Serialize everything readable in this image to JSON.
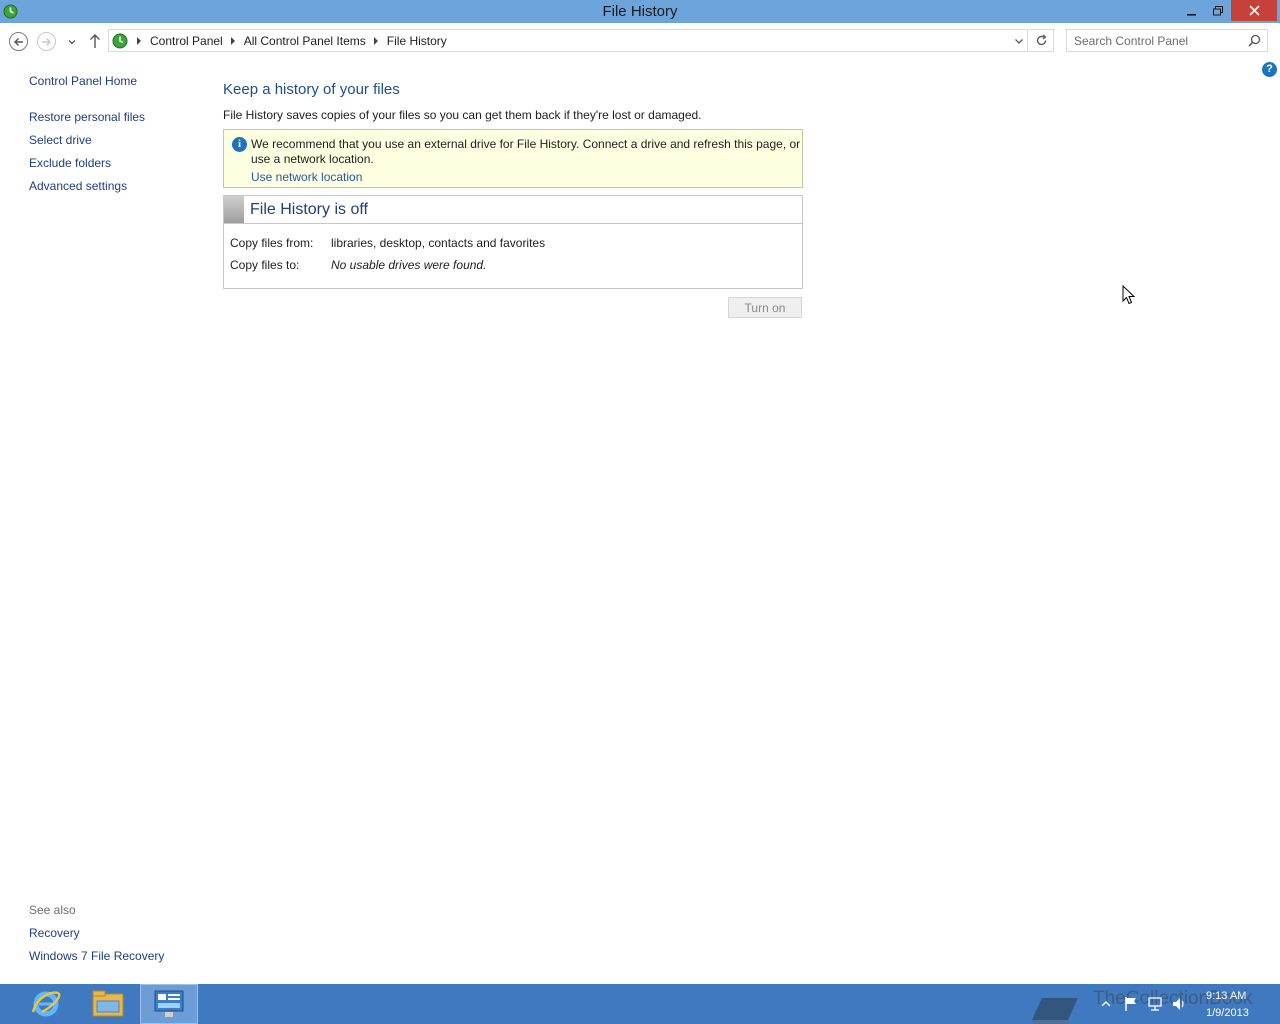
{
  "window": {
    "title": "File History"
  },
  "navigation": {
    "breadcrumbs": [
      "Control Panel",
      "All Control Panel Items",
      "File History"
    ],
    "search_placeholder": "Search Control Panel"
  },
  "left_pane": {
    "home_link": "Control Panel Home",
    "tasks": [
      "Restore personal files",
      "Select drive",
      "Exclude folders",
      "Advanced settings"
    ],
    "see_also_label": "See also",
    "see_also_links": [
      "Recovery",
      "Windows 7 File Recovery"
    ]
  },
  "main": {
    "heading": "Keep a history of your files",
    "description": "File History saves copies of your files so you can get them back if they're lost or damaged.",
    "info_bar": {
      "message": "We recommend that you use an external drive for File History. Connect a drive and refresh this page, or use a network location.",
      "link": "Use network location"
    },
    "status": {
      "title": "File History is off",
      "copy_from_label": "Copy files from:",
      "copy_from_value": "libraries, desktop, contacts and favorites",
      "copy_to_label": "Copy files to:",
      "copy_to_value": "No usable drives were found."
    },
    "turn_on_button": "Turn on"
  },
  "taskbar": {
    "watermark": "TheCollectionBook",
    "clock_time": "9:13 AM",
    "clock_date": "1/9/2013"
  },
  "colors": {
    "titlebar": "#6ea4dc",
    "close_button": "#c7413b",
    "taskbar": "#3f79bf",
    "link": "#1c3e84",
    "heading": "#1e4e8c",
    "info_bar_bg": "#ffffe1"
  }
}
